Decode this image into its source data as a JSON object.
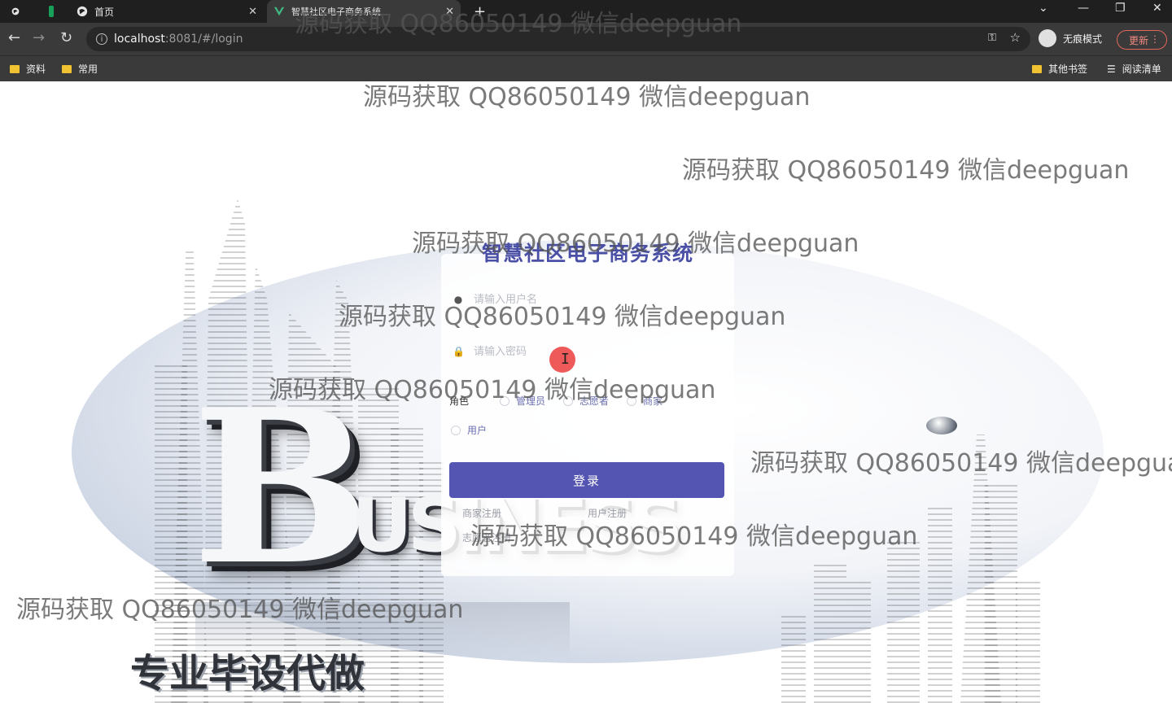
{
  "browser": {
    "tabs": [
      {
        "label": "首页",
        "active": false
      },
      {
        "label": "智慧社区电子商务系统",
        "active": true
      }
    ],
    "new_tab": "+",
    "url_host": "localhost",
    "url_rest": ":8081/#/login",
    "incognito_label": "无痕模式",
    "update_label": "更新",
    "bookmarks": [
      "资料",
      "常用"
    ],
    "other_bookmarks": "其他书签",
    "reading_list": "阅读清单"
  },
  "login": {
    "title": "智慧社区电子商务系统",
    "username_placeholder": "请输入用户名",
    "password_placeholder": "请输入密码",
    "role_label": "角色",
    "roles": [
      "管理员",
      "志愿者",
      "商家",
      "用户"
    ],
    "submit_label": "登录",
    "merchant_register": "商家注册",
    "user_register": "用户注册",
    "volunteer_register": "志愿者注册"
  },
  "slogan": "专业毕设代做",
  "watermark": "源码获取 QQ86050149 微信deepguan",
  "watermark_cut": "源码获取 QQ86050149 微信deepgua",
  "colors": {
    "accent": "#5455b2",
    "title": "#4a4fa6",
    "chrome_dark": "#1f1f1f",
    "chrome": "#3a3a3a"
  }
}
